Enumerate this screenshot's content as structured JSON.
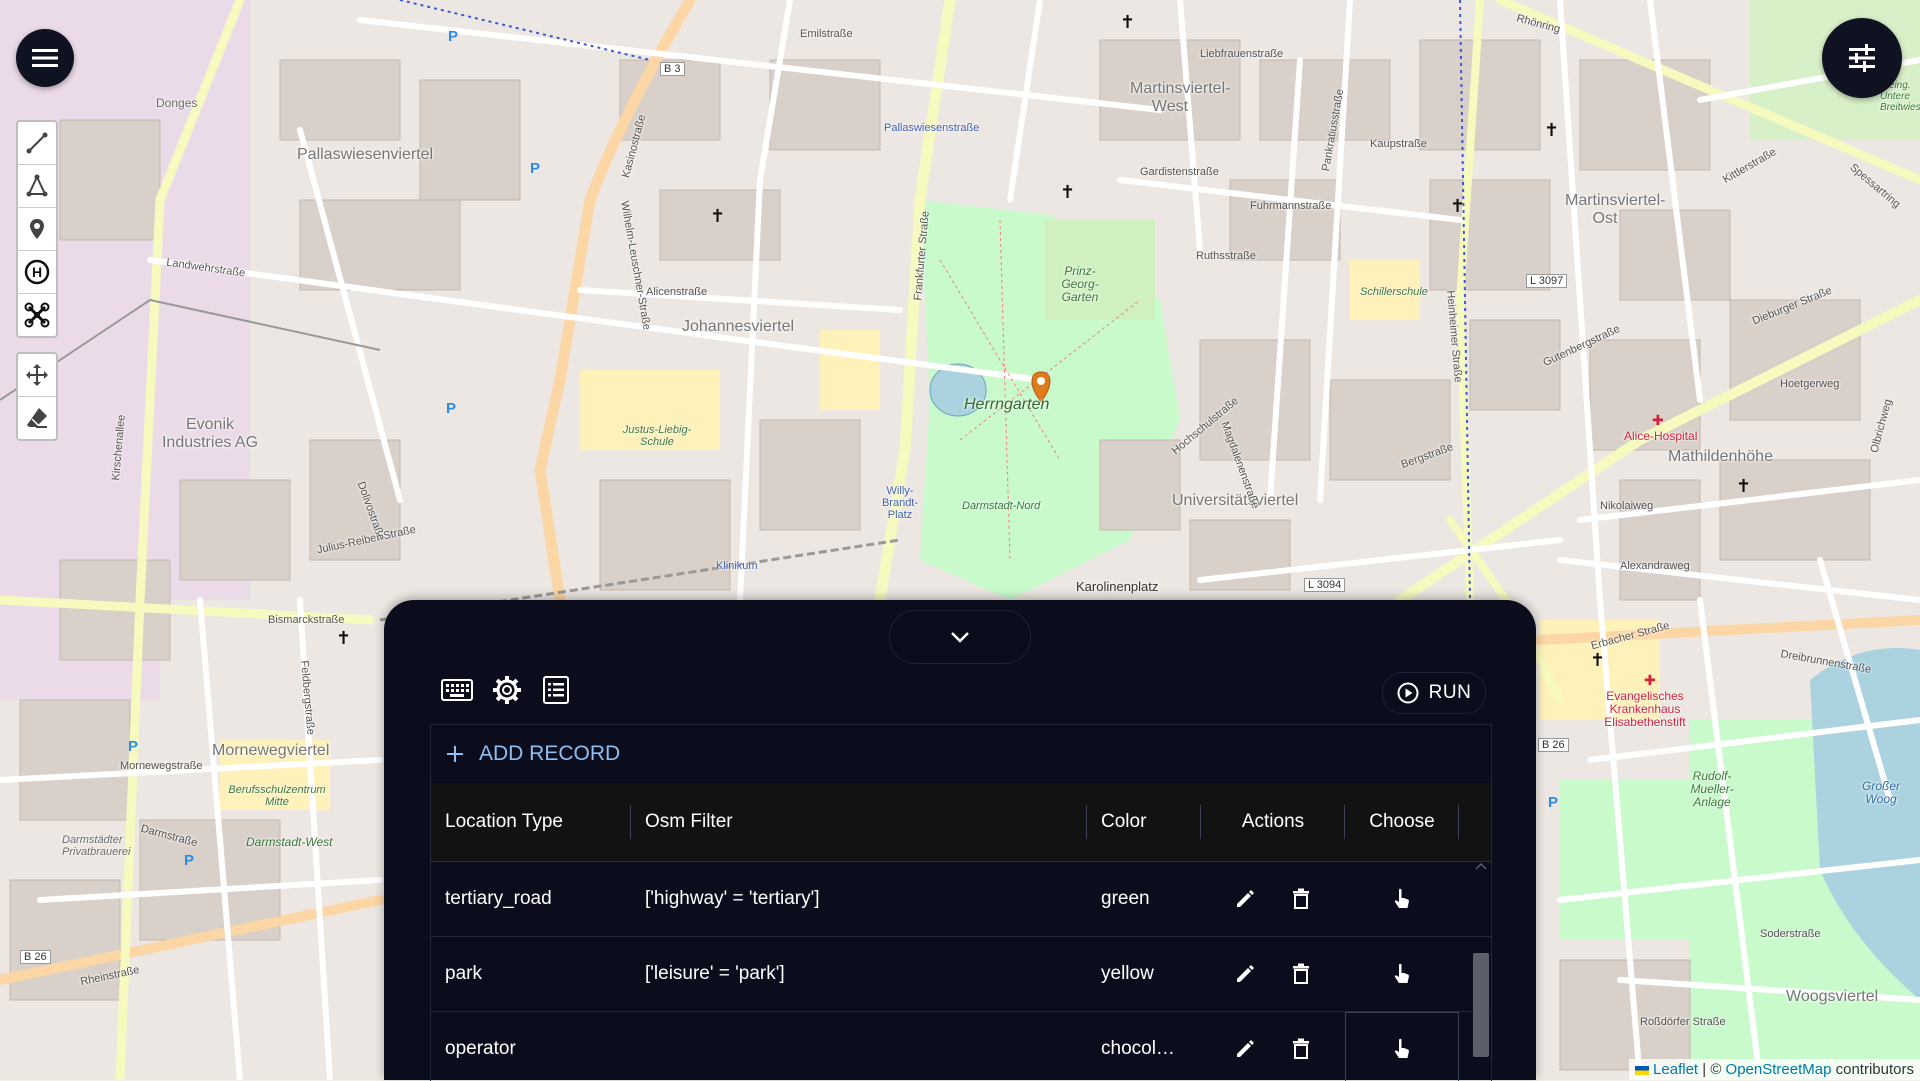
{
  "map": {
    "districts": [
      "Pallaswiesenviertel",
      "Johannesviertel",
      "Martinsviertel-West",
      "Martinsviertel-Ost",
      "Universitätsviertel",
      "Mathildenhöhe",
      "Mornewegviertel",
      "Woogsviertel",
      "Karolinenplatz"
    ],
    "labels": {
      "donges": "Donges",
      "evonik": "Evonik Industries AG",
      "herrngarten": "Herrngarten",
      "prinz_georg": "Prinz-Georg-Garten",
      "alice": "Alice-Hospital",
      "evangelisches": "Evangelisches Krankenhaus Elisabethenstift",
      "rudolf": "Rudolf-Mueller-Anlage",
      "grosser_woog": "Großer Woog",
      "justus": "Justus-Liebig-Schule",
      "schillerschule": "Schillerschule",
      "berufsschul": "Berufsschulzentrum Mitte",
      "darmstaedter": "Darmstädter Privatbrauerei",
      "darmstadt_west": "Darmstadt-West",
      "willy1": "Willy-Brandt-Platz",
      "klinikum": "Klinikum",
      "pallas_str": "Pallaswiesenstraße",
      "kleingarten": "Kleing. Untere Breitwiese",
      "darmstadt_nord": "Darmstadt-Nord"
    },
    "streets": [
      "Emilstraße",
      "Frankfurter Straße",
      "Liebfrauenstraße",
      "Kaupstraße",
      "Rhönring",
      "Landwehrstraße",
      "Alicenstraße",
      "Kirschenallee",
      "Bismarckstraße",
      "Rheinstraße",
      "Kasinostraße",
      "Dieburger Straße",
      "Heinheimer Straße",
      "Pankratiusstraße",
      "Magdalenenstraße",
      "Hochschulstraße",
      "Gutenbergstraße",
      "Nikolaiweg",
      "Alexandraweg",
      "Erbacher Straße",
      "Dreibrunnenstraße",
      "Soderstraße",
      "Roßdörfer Straße",
      "Julius-Reiber-Straße",
      "Spessartring",
      "Mornewegstraße",
      "Darmstraße",
      "Ruthsstraße",
      "Gardistenstraße",
      "Fuhrmannstraße",
      "Kittlerstraße",
      "Olbrichweg",
      "Hoetgerweg",
      "Bergstraße",
      "Dolivostraße",
      "Feldbergstraße",
      "Wilhelm-Leuschner-Straße"
    ],
    "road_refs": [
      "B 3",
      "B 26",
      "L 3097",
      "L 3094",
      "B 26"
    ]
  },
  "attribution": {
    "leaflet": "Leaflet",
    "separator": " | © ",
    "osm": "OpenStreetMap",
    "suffix": " contributors"
  },
  "panel": {
    "run_label": "RUN",
    "add_record_label": "ADD RECORD",
    "columns": [
      "Location Type",
      "Osm Filter",
      "Color",
      "Actions",
      "Choose"
    ],
    "rows": [
      {
        "location_type": "tertiary_road",
        "osm_filter": "['highway' = 'tertiary']",
        "color": "green"
      },
      {
        "location_type": "park",
        "osm_filter": "['leisure' = 'park']",
        "color": "yellow"
      },
      {
        "location_type": "operator",
        "osm_filter": "",
        "color": "chocol…"
      }
    ]
  },
  "icons": {
    "menu": "hamburger-icon",
    "settings": "sliders-icon",
    "collapse": "chevron-down-icon",
    "keyboard": "keyboard-icon",
    "gear": "gear-icon",
    "list": "list-icon",
    "run": "play-circle-icon",
    "add": "plus-icon",
    "edit": "pencil-icon",
    "delete": "trash-icon",
    "choose": "hand-pointer-icon"
  },
  "colors": {
    "panel_bg": "#0b0d1c",
    "accent": "#8fbef2",
    "marker": "#e07a1c",
    "park_green": "#c8facc"
  }
}
